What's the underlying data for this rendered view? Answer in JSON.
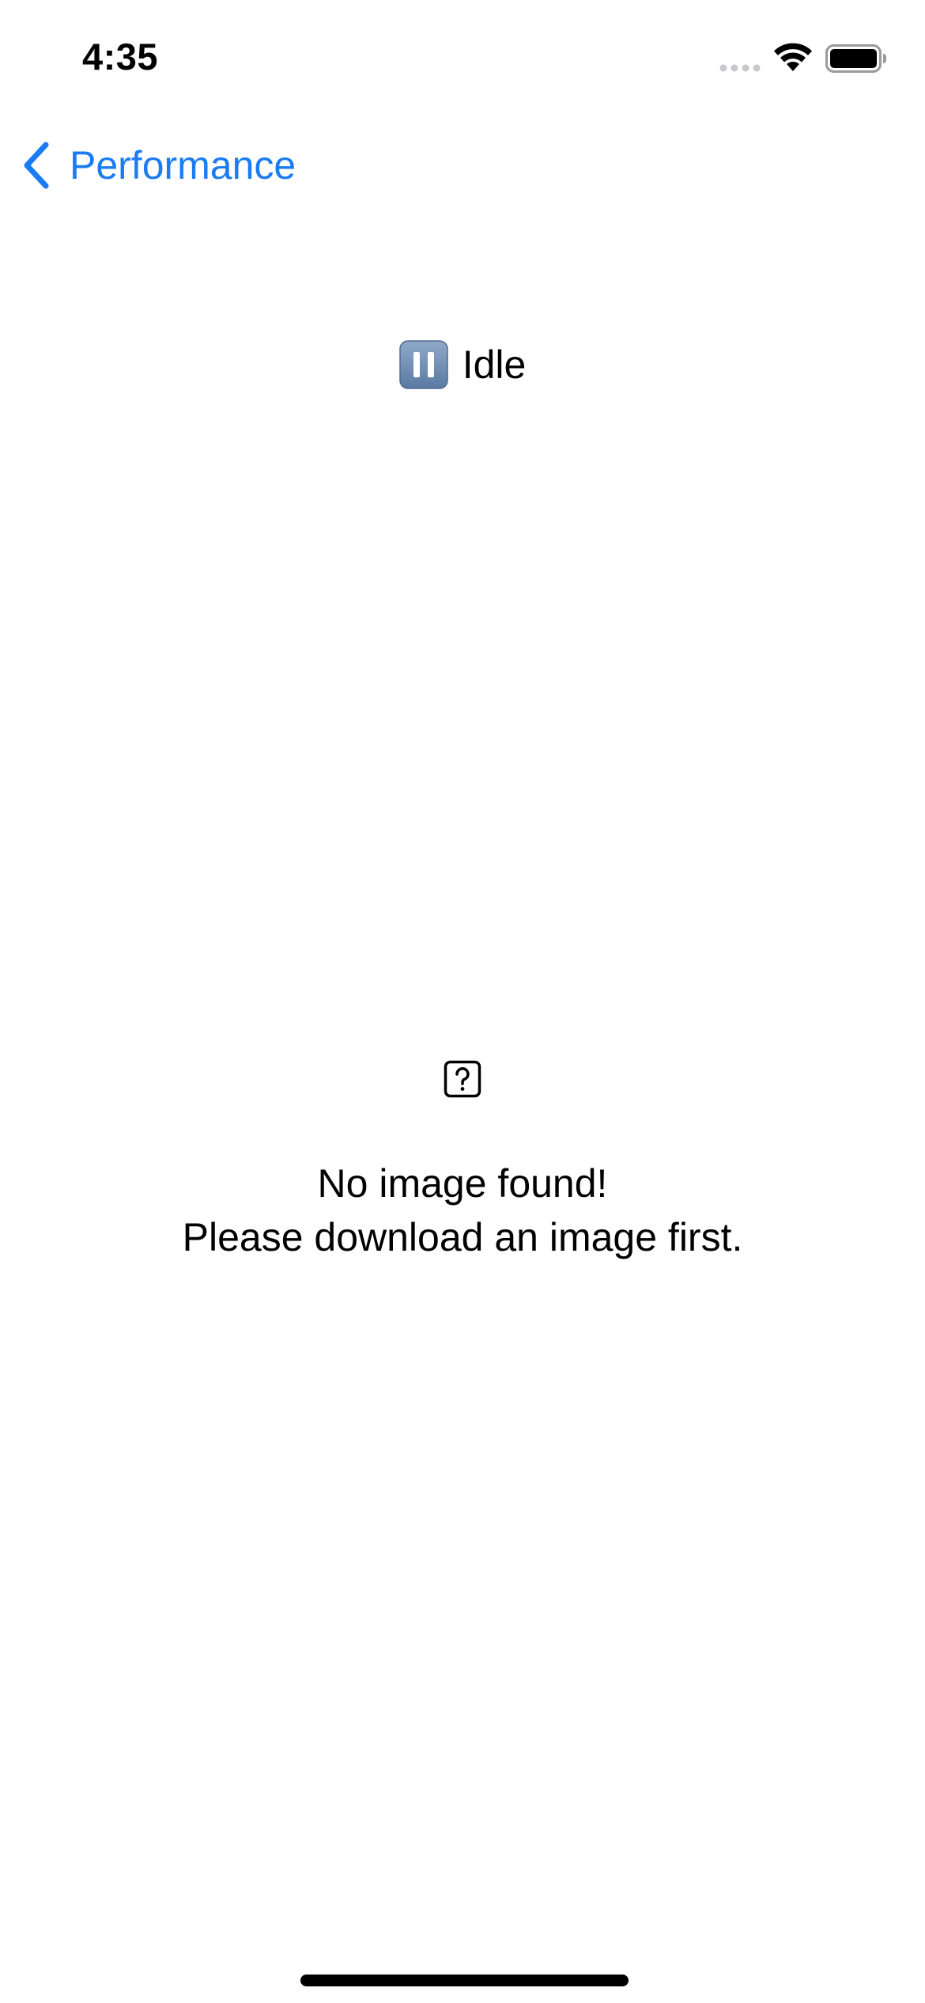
{
  "status_bar": {
    "time": "4:35",
    "signal_icon": "cellular-signal-icon",
    "wifi_icon": "wifi-icon",
    "battery_icon": "battery-icon",
    "battery_level": 1.0
  },
  "nav": {
    "back_icon": "chevron-left-icon",
    "back_label": "Performance",
    "accent_color": "#1a7cf5"
  },
  "state": {
    "icon": "pause-icon",
    "label": "Idle"
  },
  "empty_state": {
    "icon": "question-mark-icon",
    "line1": "No image found!",
    "line2": "Please download an image first."
  }
}
